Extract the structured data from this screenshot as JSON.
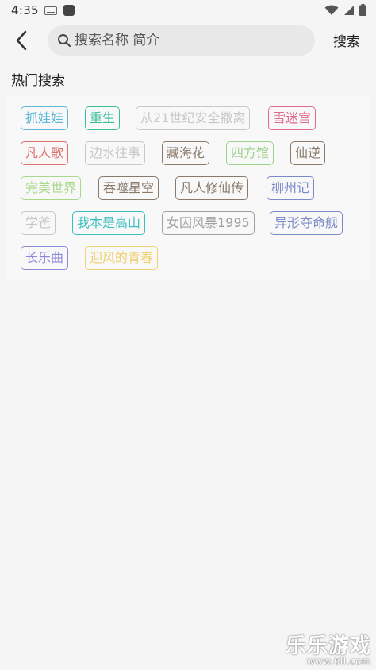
{
  "status_bar": {
    "time": "4:35"
  },
  "search": {
    "placeholder": "搜索名称 简介",
    "value": "",
    "submit_label": "搜索"
  },
  "hot_search": {
    "title": "热门搜索",
    "tags": [
      {
        "label": "抓娃娃",
        "color": "#5bb8d8"
      },
      {
        "label": "重生",
        "color": "#3bbf9a"
      },
      {
        "label": "从21世纪安全撤离",
        "color": "#c8c8c8"
      },
      {
        "label": "雪迷宫",
        "color": "#e06a8a"
      },
      {
        "label": "凡人歌",
        "color": "#e07070"
      },
      {
        "label": "边水往事",
        "color": "#c8c8c8"
      },
      {
        "label": "藏海花",
        "color": "#8a7a6a"
      },
      {
        "label": "四方馆",
        "color": "#9bd18a"
      },
      {
        "label": "仙逆",
        "color": "#8a7a6a"
      },
      {
        "label": "完美世界",
        "color": "#a8d88a"
      },
      {
        "label": "吞噬星空",
        "color": "#8a7a6a"
      },
      {
        "label": "凡人修仙传",
        "color": "#8a7a6a"
      },
      {
        "label": "柳州记",
        "color": "#7a8ac8"
      },
      {
        "label": "学爸",
        "color": "#c8c8c8"
      },
      {
        "label": "我本是高山",
        "color": "#3bbfbf"
      },
      {
        "label": "女囚风暴1995",
        "color": "#a0a0a0"
      },
      {
        "label": "异形夺命舰",
        "color": "#7a8ac8"
      },
      {
        "label": "长乐曲",
        "color": "#8a8ad8"
      },
      {
        "label": "迎风的青春",
        "color": "#f0d070"
      }
    ]
  },
  "watermark": {
    "title": "乐乐游戏",
    "url": "www.6ll.com"
  }
}
